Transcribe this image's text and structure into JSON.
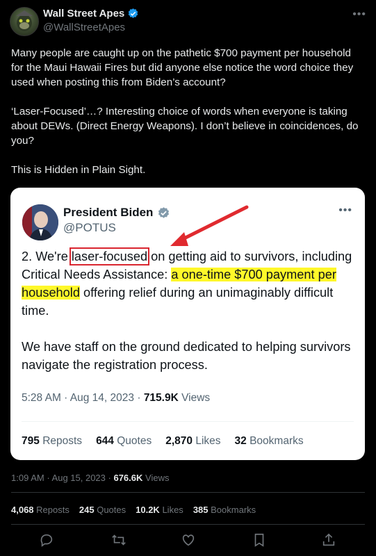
{
  "tweet": {
    "author_name": "Wall Street Apes",
    "author_handle": "@WallStreetApes",
    "paragraphs": [
      "Many people are caught up on the pathetic $700 payment per household for the Maui Hawaii Fires but did anyone else notice the word choice they used when posting this from Biden’s account?",
      "‘Laser-Focused’…? Interesting choice of words when everyone is taking about DEWs. (Direct Energy Weapons). I don’t believe in coincidences, do you?",
      "This is Hidden in Plain Sight."
    ],
    "time": "1:09 AM",
    "date": "Aug 15, 2023",
    "views_count": "676.6K",
    "views_label": "Views",
    "stats": {
      "reposts_count": "4,068",
      "reposts_label": "Reposts",
      "quotes_count": "245",
      "quotes_label": "Quotes",
      "likes_count": "10.2K",
      "likes_label": "Likes",
      "bookmarks_count": "385",
      "bookmarks_label": "Bookmarks"
    }
  },
  "quoted": {
    "author_name": "President Biden",
    "author_handle": "@POTUS",
    "p1_a": "2. We're ",
    "p1_boxed": "laser-focused",
    "p1_b": " on getting aid to survivors, including Critical Needs Assistance: ",
    "p1_hl": "a one-time $700 payment per household",
    "p1_c": " offering relief during an unimaginably difficult time.",
    "p2": "We have staff on the ground dedicated to helping survivors navigate the registration process.",
    "time": "5:28 AM",
    "date": "Aug 14, 2023",
    "views_count": "715.9K",
    "views_label": "Views",
    "stats": {
      "reposts_count": "795",
      "reposts_label": "Reposts",
      "quotes_count": "644",
      "quotes_label": "Quotes",
      "likes_count": "2,870",
      "likes_label": "Likes",
      "bookmarks_count": "32",
      "bookmarks_label": "Bookmarks"
    }
  },
  "icons": [
    "verified-badge-icon",
    "more-icon",
    "reply-icon",
    "repost-icon",
    "like-icon",
    "bookmark-icon",
    "share-icon"
  ],
  "colors": {
    "accent": "#1d9bf0",
    "annotation_red": "#e02a2f",
    "highlight": "#fff82a"
  }
}
